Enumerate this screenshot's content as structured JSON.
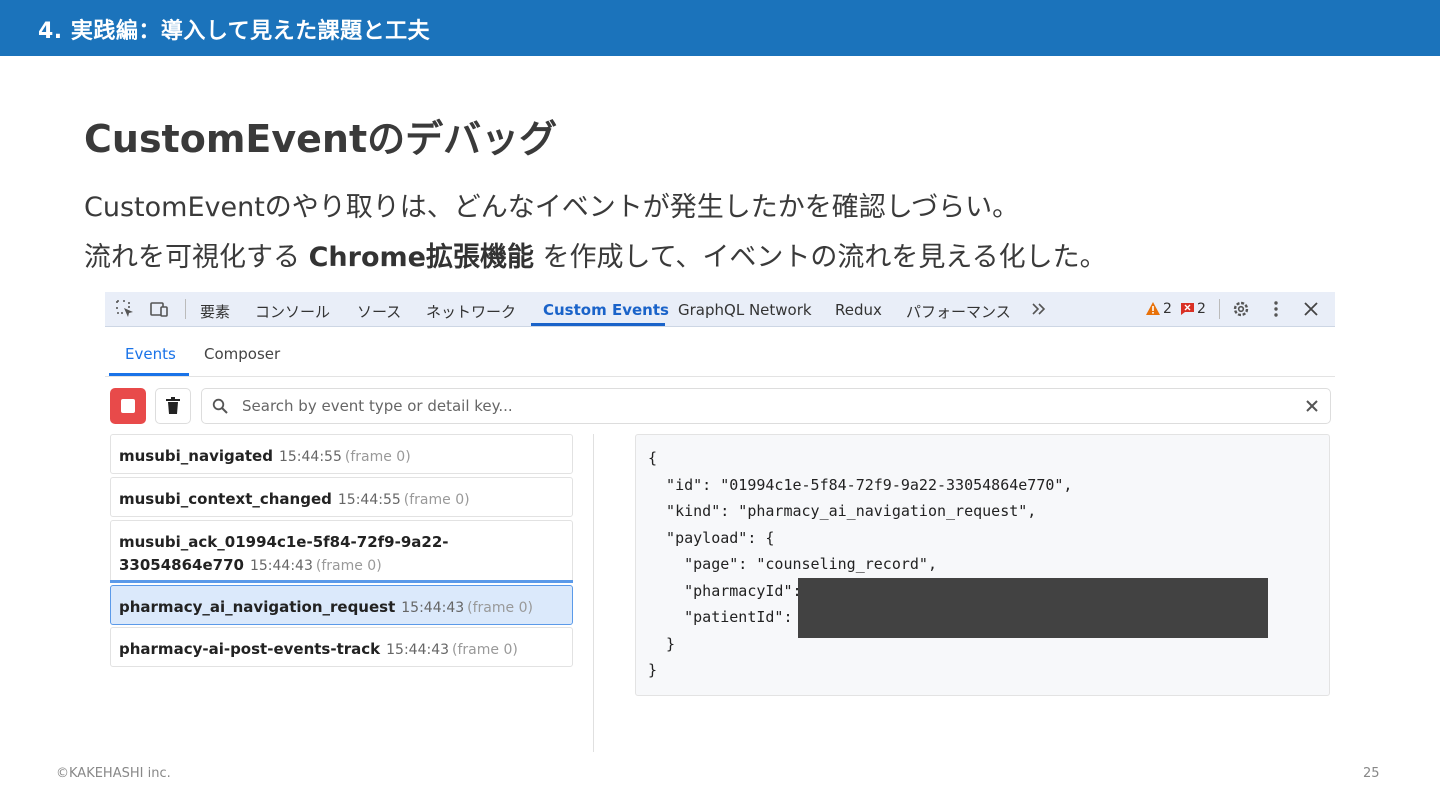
{
  "header": {
    "section_title": "4. 実践編：導入して見えた課題と工夫"
  },
  "slide": {
    "title": "CustomEventのデバッグ",
    "line1": "CustomEventのやり取りは、どんなイベントが発生したかを確認しづらい。",
    "line2_pre": "流れを可視化する ",
    "line2_bold": "Chrome拡張機能",
    "line2_post": " を作成して、イベントの流れを見える化した。"
  },
  "devtools": {
    "tabs": [
      "要素",
      "コンソール",
      "ソース",
      "ネットワーク",
      "Custom Events",
      "GraphQL Network",
      "Redux",
      "パフォーマンス"
    ],
    "active_tab": "Custom Events",
    "warning_count": "2",
    "error_count": "2",
    "subtabs": [
      "Events",
      "Composer"
    ],
    "search_placeholder": "Search by event type or detail key...",
    "events": [
      {
        "name": "musubi_navigated",
        "time": "15:44:55",
        "frame": "(frame 0)"
      },
      {
        "name": "musubi_context_changed",
        "time": "15:44:55",
        "frame": "(frame 0)"
      },
      {
        "name": "musubi_ack_01994c1e-5f84-72f9-9a22-33054864e770",
        "time": "15:44:43",
        "frame": "(frame 0)"
      },
      {
        "name": "pharmacy_ai_navigation_request",
        "time": "15:44:43",
        "frame": "(frame 0)"
      },
      {
        "name": "pharmacy-ai-post-events-track",
        "time": "15:44:43",
        "frame": "(frame 0)"
      }
    ],
    "json_lines": [
      "{",
      "  \"id\": \"01994c1e-5f84-72f9-9a22-33054864e770\",",
      "  \"kind\": \"pharmacy_ai_navigation_request\",",
      "  \"payload\": {",
      "    \"page\": \"counseling_record\",",
      "    \"pharmacyId\":",
      "    \"patientId\":",
      "  }",
      "}"
    ]
  },
  "footer": {
    "copyright": "©KAKEHASHI inc.",
    "page_number": "25"
  },
  "colors": {
    "header_blue": "#1b73bb",
    "tab_active": "#1a63c9",
    "record_red": "#e84a4a"
  }
}
